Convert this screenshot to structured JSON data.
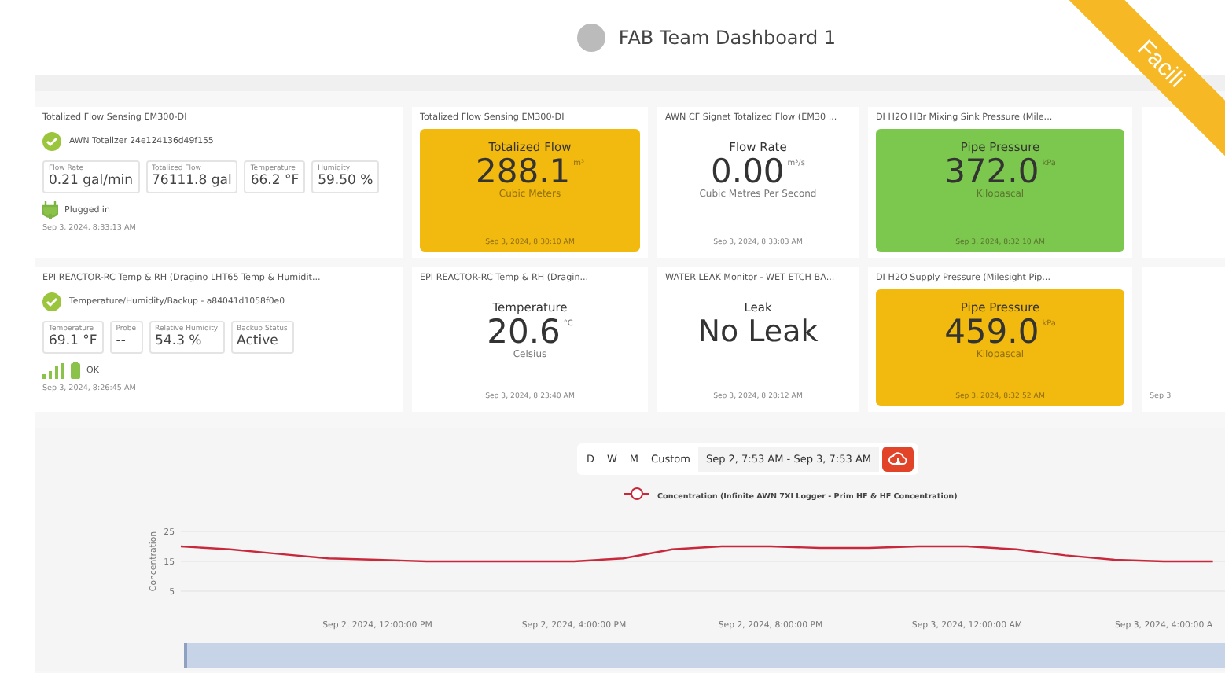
{
  "header": {
    "title": "FAB Team Dashboard 1",
    "ribbon": "Facili"
  },
  "cards": [
    {
      "kind": "device",
      "title": "Totalized Flow Sensing EM300-DI",
      "device": "AWN Totalizer  24e124136d49f155",
      "readings": [
        {
          "label": "Flow Rate",
          "value": "0.21 gal/min"
        },
        {
          "label": "Totalized Flow",
          "value": "76111.8 gal"
        },
        {
          "label": "Temperature",
          "value": "66.2 °F"
        },
        {
          "label": "Humidity",
          "value": "59.50 %"
        }
      ],
      "status": {
        "kind": "plug",
        "text": "Plugged in"
      },
      "timestamp": "Sep 3, 2024, 8:33:13 AM"
    },
    {
      "kind": "tile",
      "title": "Totalized Flow Sensing EM300-DI",
      "label": "Totalized Flow",
      "value": "288.1",
      "unit": "m³",
      "caption": "Cubic Meters",
      "timestamp": "Sep 3, 2024, 8:30:10 AM",
      "color": "#f2b90f"
    },
    {
      "kind": "tile",
      "title": "AWN CF Signet Totalized Flow (EM30 ...",
      "label": "Flow Rate",
      "value": "0.00",
      "unit": "m³/s",
      "caption": "Cubic Metres Per Second",
      "timestamp": "Sep 3, 2024, 8:33:03 AM"
    },
    {
      "kind": "tile",
      "title": "DI H2O HBr Mixing Sink Pressure (Mile...",
      "label": "Pipe Pressure",
      "value": "372.0",
      "unit": "kPa",
      "caption": "Kilopascal",
      "timestamp": "Sep 3, 2024, 8:32:10 AM",
      "color": "#7cc84e"
    },
    {
      "kind": "blank"
    },
    {
      "kind": "device",
      "title": "EPI REACTOR-RC Temp & RH (Dragino LHT65 Temp & Humidit...",
      "device": "Temperature/Humidity/Backup - a84041d1058f0e0",
      "readings": [
        {
          "label": "Temperature",
          "value": "69.1 °F"
        },
        {
          "label": "Probe",
          "value": "--"
        },
        {
          "label": "Relative Humidity",
          "value": "54.3 %"
        },
        {
          "label": "Backup Status",
          "value": "Active"
        }
      ],
      "status": {
        "kind": "battery",
        "text": "OK"
      },
      "timestamp": "Sep 3, 2024, 8:26:45 AM"
    },
    {
      "kind": "tile",
      "title": "EPI REACTOR-RC Temp & RH (Dragin...",
      "label": "Temperature",
      "value": "20.6",
      "unit": "°C",
      "caption": "Celsius",
      "timestamp": "Sep 3, 2024, 8:23:40 AM"
    },
    {
      "kind": "tile",
      "title": "WATER LEAK Monitor - WET ETCH BA...",
      "label": "Leak",
      "value": "No Leak",
      "timestamp": "Sep 3, 2024, 8:28:12 AM"
    },
    {
      "kind": "tile",
      "title": "DI H2O Supply Pressure (Milesight Pip...",
      "label": "Pipe Pressure",
      "value": "459.0",
      "unit": "kPa",
      "caption": "Kilopascal",
      "timestamp": "Sep 3, 2024, 8:32:52 AM",
      "color": "#f2b90f"
    },
    {
      "kind": "stub",
      "timestamp": "Sep 3"
    }
  ],
  "chart_panel": {
    "ranges": [
      "D",
      "W",
      "M",
      "Custom"
    ],
    "date_range": "Sep 2, 7:53 AM - Sep 3, 7:53 AM",
    "chart_data": {
      "type": "line",
      "ylabel": "Concentration",
      "categories": [
        null,
        null,
        null,
        null,
        "Sep 2, 2024, 12:00:00 PM",
        null,
        null,
        null,
        "Sep 2, 2024, 4:00:00 PM",
        null,
        null,
        null,
        "Sep 2, 2024, 8:00:00 PM",
        null,
        null,
        null,
        "Sep 3, 2024, 12:00:00 AM",
        null,
        null,
        null,
        "Sep 3, 2024, 4:00:00 A",
        null
      ],
      "series": [
        {
          "name": "Concentration (Infinite AWN 7XI Logger - Prim HF & HF Concentration)",
          "color": "#c8283c",
          "values": [
            20,
            19,
            17.5,
            16,
            15.5,
            15,
            15,
            15,
            15,
            16,
            19,
            20,
            20,
            19.5,
            19.5,
            20,
            20,
            19,
            17,
            15.5,
            15,
            15
          ]
        }
      ],
      "ylim": [
        5,
        25
      ],
      "yticks": [
        5,
        15,
        25
      ],
      "grid": true
    }
  }
}
